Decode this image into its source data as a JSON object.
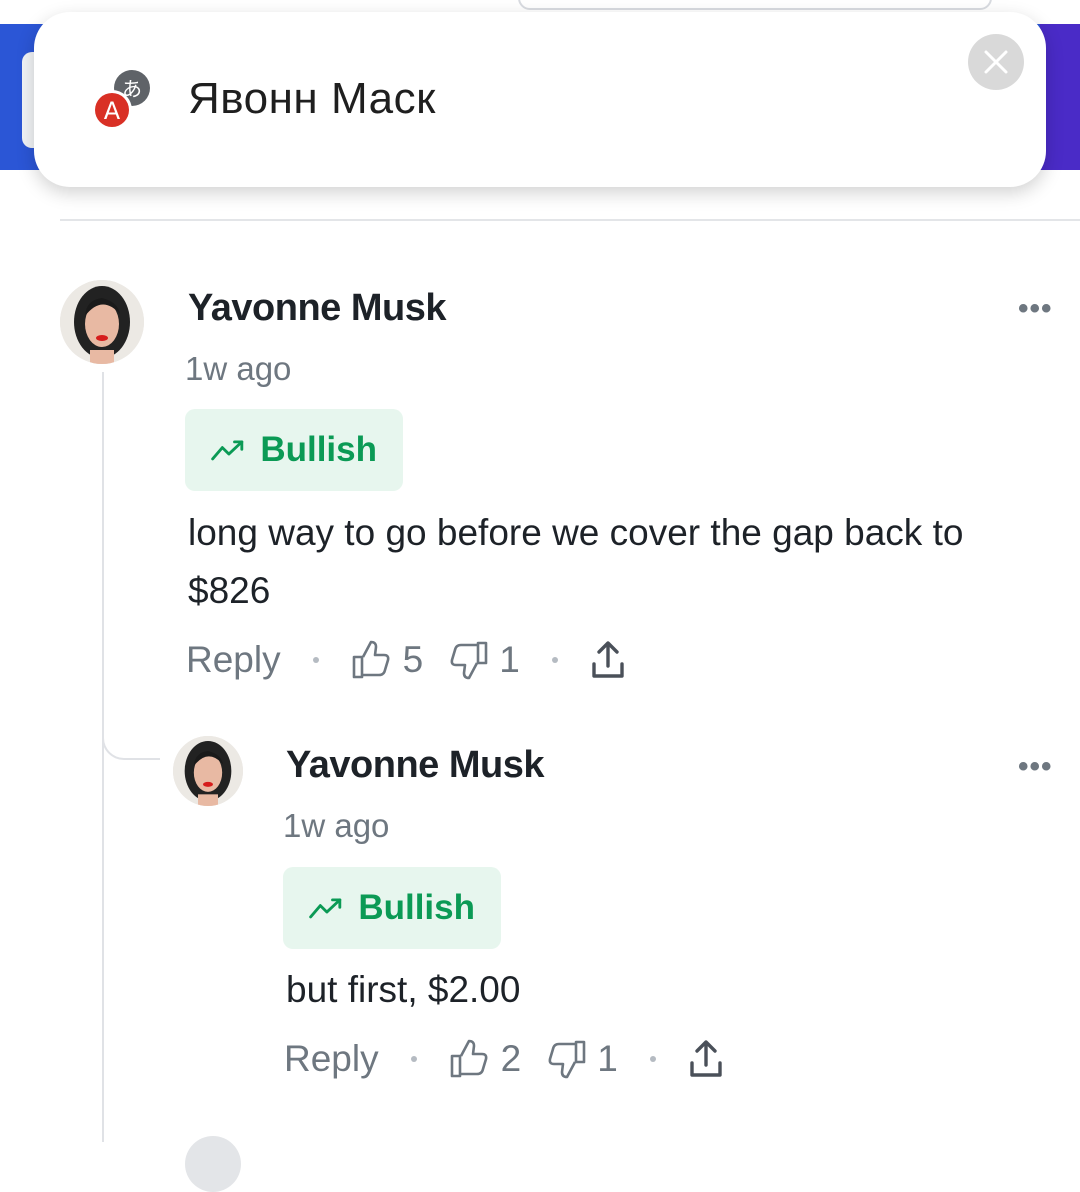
{
  "translate_popup": {
    "translated_text": "Явонн Маск",
    "icon": "translate-icon",
    "close_icon": "close-icon"
  },
  "colors": {
    "bullish_green": "#0b9a55",
    "bullish_bg": "#e7f6ee",
    "header_blue": "#2b56d6",
    "text_gray": "#6e7780"
  },
  "comments": [
    {
      "author": "Yavonne Musk",
      "time": "1w ago",
      "sentiment": "Bullish",
      "text": "long way to go before we cover the gap back to $826",
      "reply_label": "Reply",
      "likes": "5",
      "dislikes": "1",
      "more": "•••"
    },
    {
      "author": "Yavonne Musk",
      "time": "1w ago",
      "sentiment": "Bullish",
      "text": "but first, $2.00",
      "reply_label": "Reply",
      "likes": "2",
      "dislikes": "1",
      "more": "•••"
    }
  ]
}
